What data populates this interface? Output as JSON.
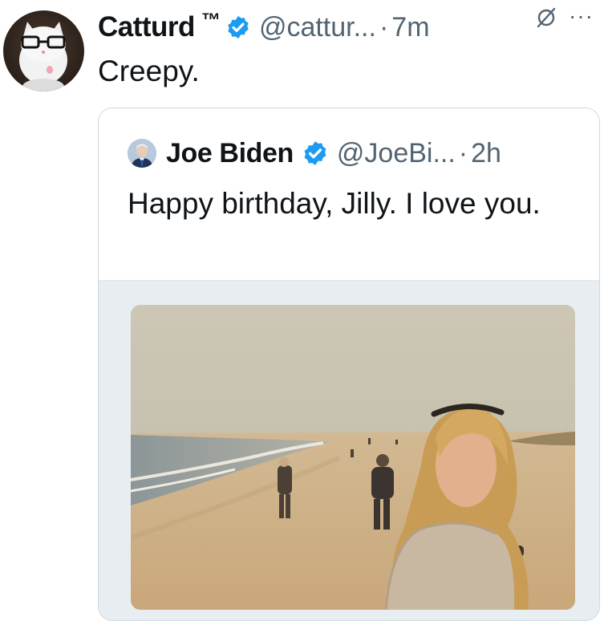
{
  "post": {
    "author_name": "Catturd",
    "trademark": "™",
    "handle": "@cattur...",
    "separator": "·",
    "time": "7m",
    "text": "Creepy.",
    "more_label": "···",
    "avatar_icon": "cat-with-glasses-avatar",
    "grok_icon": "grok-icon"
  },
  "quoted": {
    "author_name": "Joe Biden",
    "handle": "@JoeBi...",
    "separator": "·",
    "time": "2h",
    "text": "Happy birthday, Jilly. I love you.",
    "avatar_icon": "person-avatar",
    "media": {
      "description_icon": "beach-photo"
    }
  },
  "colors": {
    "verified_blue": "#1d9bf0",
    "secondary_text": "#536471",
    "border": "#cfd9de"
  }
}
